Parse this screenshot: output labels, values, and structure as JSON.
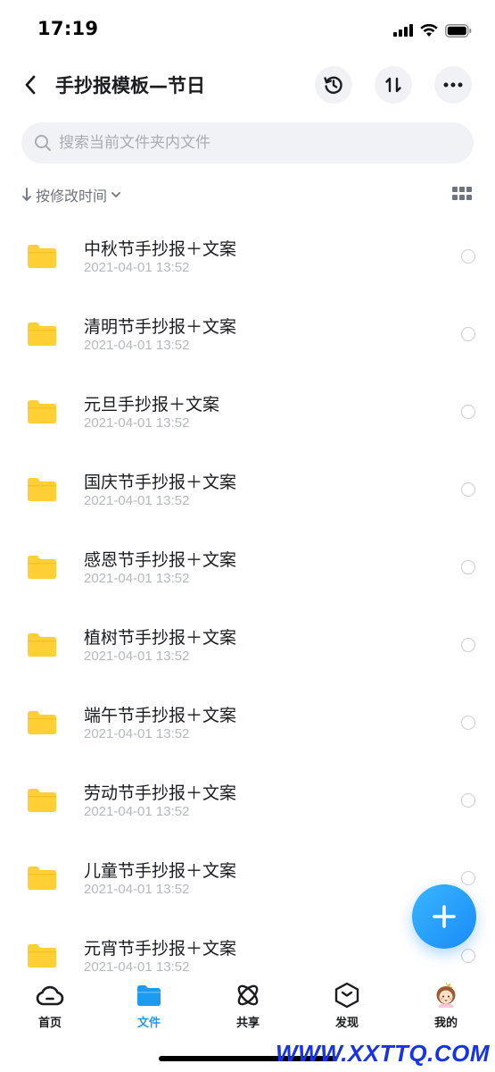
{
  "status_bar": {
    "time": "17:19"
  },
  "header": {
    "title": "手抄报模板—节日"
  },
  "search": {
    "placeholder": "搜索当前文件夹内文件",
    "value": ""
  },
  "sort": {
    "label": "按修改时间"
  },
  "files": [
    {
      "name": "中秋节手抄报＋文案",
      "date": "2021-04-01 13:52"
    },
    {
      "name": "清明节手抄报＋文案",
      "date": "2021-04-01 13:52"
    },
    {
      "name": "元旦手抄报＋文案",
      "date": "2021-04-01 13:52"
    },
    {
      "name": "国庆节手抄报＋文案",
      "date": "2021-04-01 13:52"
    },
    {
      "name": "感恩节手抄报＋文案",
      "date": "2021-04-01 13:52"
    },
    {
      "name": "植树节手抄报＋文案",
      "date": "2021-04-01 13:52"
    },
    {
      "name": "端午节手抄报＋文案",
      "date": "2021-04-01 13:52"
    },
    {
      "name": "劳动节手抄报＋文案",
      "date": "2021-04-01 13:52"
    },
    {
      "name": "儿童节手抄报＋文案",
      "date": "2021-04-01 13:52"
    },
    {
      "name": "元宵节手抄报＋文案",
      "date": "2021-04-01 13:52"
    }
  ],
  "tabs": [
    {
      "label": "首页",
      "icon": "cloud-icon"
    },
    {
      "label": "文件",
      "icon": "folder-icon",
      "active": true
    },
    {
      "label": "共享",
      "icon": "atom-icon"
    },
    {
      "label": "发现",
      "icon": "cube-icon"
    },
    {
      "label": "我的",
      "icon": "avatar-icon"
    }
  ],
  "watermark": "WWW.XXTTQ.COM",
  "colors": {
    "accent": "#1d9bf0",
    "folder": "#ffd035",
    "title_text": "#1b1c20",
    "secondary_text": "#b5b8bf",
    "button_bg": "#f1f2f5",
    "watermark": "#1633e6"
  }
}
